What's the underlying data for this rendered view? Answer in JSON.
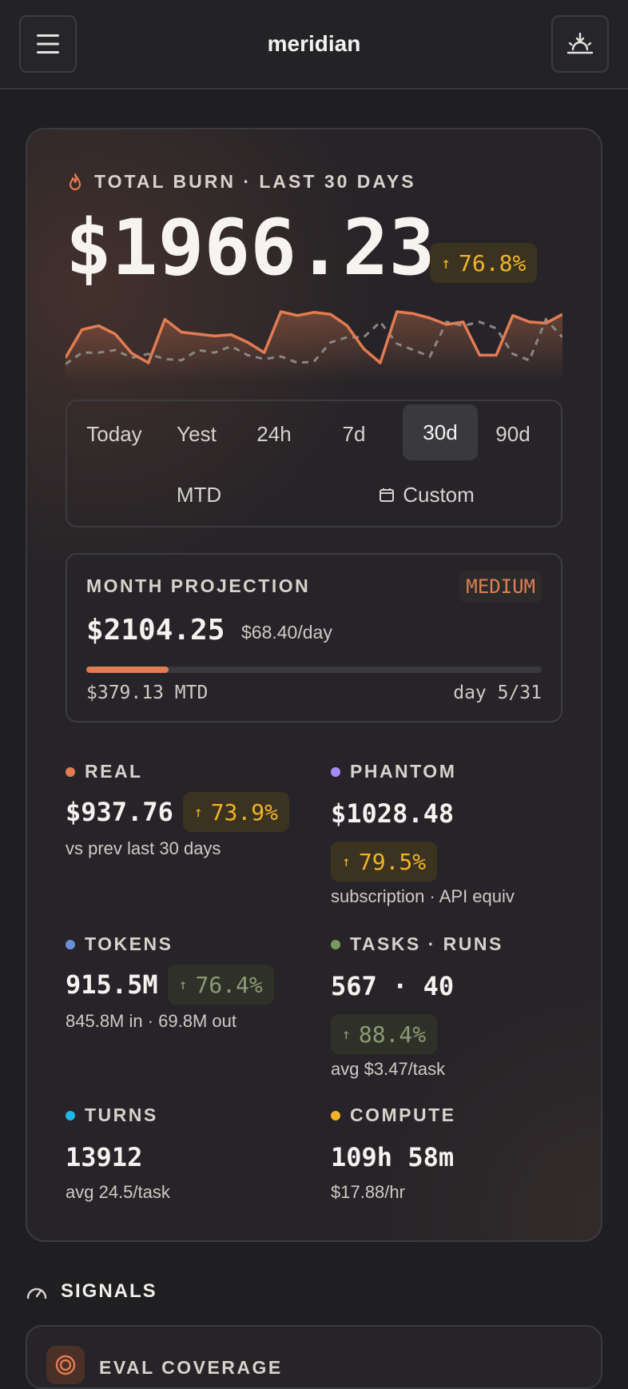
{
  "header": {
    "title": "meridian"
  },
  "hero": {
    "label": "TOTAL BURN · LAST 30 DAYS",
    "amount": "$1966.23",
    "change": "76.8%"
  },
  "ranges": {
    "items": [
      "Today",
      "Yest",
      "24h",
      "7d",
      "30d",
      "90d"
    ],
    "mtd": "MTD",
    "custom": "Custom",
    "active": "30d"
  },
  "projection": {
    "title": "MONTH PROJECTION",
    "badge": "MEDIUM",
    "amount": "$2104.25",
    "rate": "$68.40/day",
    "progress_fraction": 0.18,
    "mtd": "$379.13 MTD",
    "day": "day 5/31"
  },
  "stats": {
    "real": {
      "label": "REAL",
      "value": "$937.76",
      "change": "73.9%",
      "sub": "vs prev last 30 days"
    },
    "phantom": {
      "label": "PHANTOM",
      "value": "$1028.48",
      "change": "79.5%",
      "sub": "subscription · API equiv"
    },
    "tokens": {
      "label": "TOKENS",
      "value": "915.5M",
      "change": "76.4%",
      "sub": "845.8M in · 69.8M out"
    },
    "tasks": {
      "label": "TASKS · RUNS",
      "value": "567 · 40",
      "change": "88.4%",
      "sub": "avg $3.47/task"
    },
    "turns": {
      "label": "TURNS",
      "value": "13912",
      "sub": "avg 24.5/task"
    },
    "compute": {
      "label": "COMPUTE",
      "value": "109h 58m",
      "sub": "$17.88/hr"
    }
  },
  "colors": {
    "accent": "#e27c52",
    "amber": "#f0b429",
    "green": "#8c9a74",
    "phantom": "#a78bfa",
    "tokens": "#6b8fd6",
    "tasks": "#7a9a5c",
    "turns": "#1fb6e8",
    "compute": "#f0b429"
  },
  "signals": {
    "title": "SIGNALS",
    "card_title": "EVAL COVERAGE"
  },
  "sparkline": {
    "current": [
      0.28,
      0.72,
      0.78,
      0.65,
      0.35,
      0.2,
      0.88,
      0.68,
      0.65,
      0.62,
      0.64,
      0.52,
      0.36,
      1.0,
      0.94,
      0.99,
      0.96,
      0.78,
      0.42,
      0.2,
      1.0,
      0.97,
      0.9,
      0.8,
      0.84,
      0.32,
      0.32,
      0.94,
      0.84,
      0.82,
      0.96
    ],
    "previous": [
      0.18,
      0.36,
      0.36,
      0.4,
      0.28,
      0.34,
      0.26,
      0.24,
      0.4,
      0.36,
      0.46,
      0.32,
      0.26,
      0.3,
      0.2,
      0.22,
      0.52,
      0.6,
      0.6,
      0.84,
      0.5,
      0.4,
      0.3,
      0.84,
      0.78,
      0.84,
      0.74,
      0.34,
      0.24,
      0.88,
      0.6
    ]
  }
}
